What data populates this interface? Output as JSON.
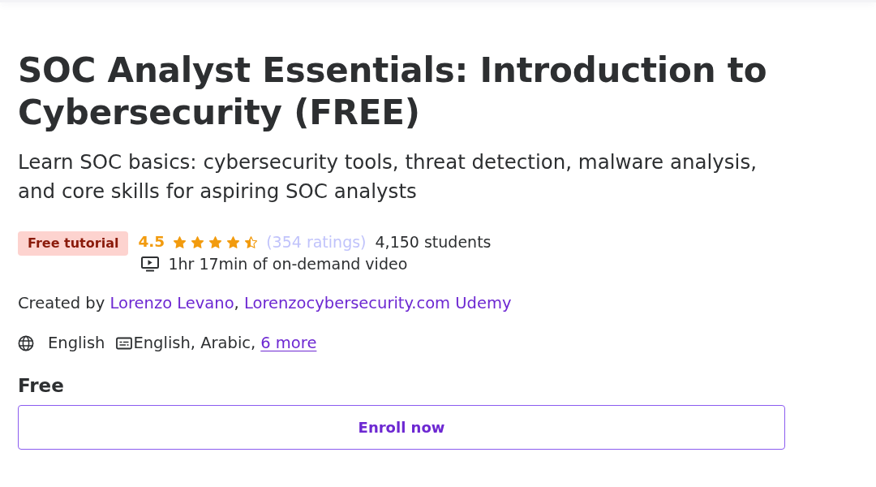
{
  "course": {
    "title": "SOC Analyst Essentials: Introduction to Cybersecurity (FREE)",
    "subtitle": "Learn SOC basics: cybersecurity tools, threat detection, malware analysis, and core skills for aspiring SOC analysts",
    "badge": "Free tutorial",
    "rating": "4.5",
    "stars": 4.5,
    "ratings_count": "(354 ratings)",
    "students": "4,150 students",
    "duration": "1hr 17min of on-demand video",
    "created_by": {
      "label": "Created by",
      "separator": ",",
      "links": [
        "Lorenzo Levano",
        "Lorenzocybersecurity.com Udemy"
      ]
    },
    "language": "English",
    "captions": {
      "text": "English, Arabic,",
      "more_link": "6 more"
    },
    "price": "Free",
    "button": "Enroll now"
  }
}
